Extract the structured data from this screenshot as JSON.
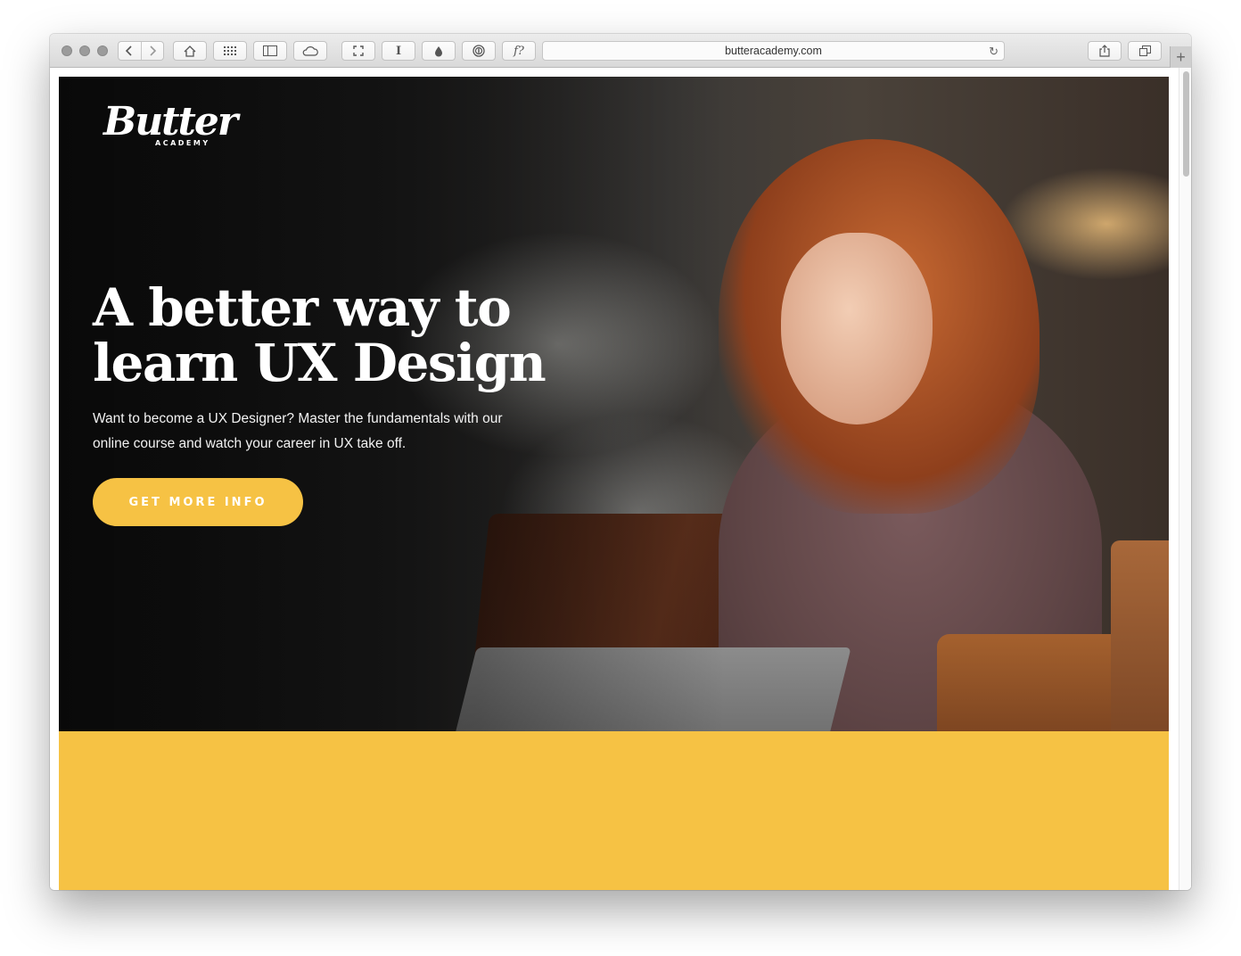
{
  "browser": {
    "url": "butteracademy.com",
    "toolbar_buttons": [
      "home-icon",
      "grid-icon",
      "sidebar-icon",
      "cloud-icon",
      "expand-icon",
      "text-cursor-icon",
      "drop-icon",
      "password-icon",
      "font-icon"
    ],
    "font_button_label": "f?",
    "text_button_label": "I",
    "new_tab_label": "+"
  },
  "site": {
    "logo_script": "Butter",
    "logo_sub": "ACADEMY",
    "headline_line1": "A better way to",
    "headline_line2": "learn UX Design",
    "subtext_line1": "Want to become a UX Designer? Master the fundamentals with our",
    "subtext_line2": "online course and watch your career in UX take off.",
    "cta_label": "GET MORE INFO"
  },
  "colors": {
    "accent": "#f6c244",
    "hero_text": "#ffffff"
  }
}
